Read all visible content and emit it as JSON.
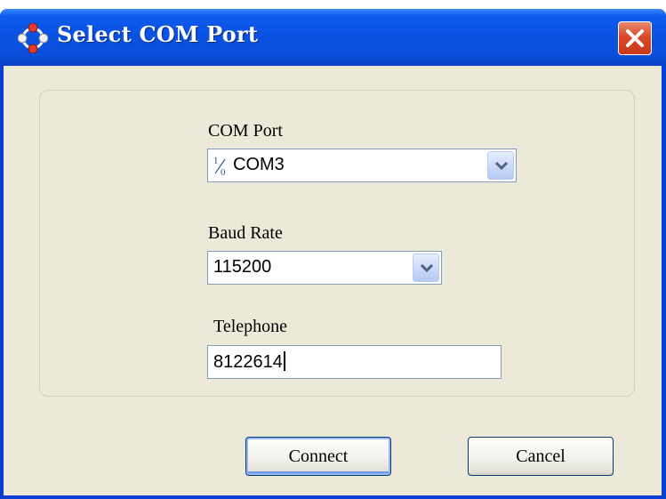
{
  "window": {
    "title": "Select COM Port",
    "title_bar_color": "#0a52e2",
    "client_color": "#ece9d8",
    "icons": {
      "app": "com-port-app-icon",
      "close": "close-icon"
    }
  },
  "form": {
    "com_port": {
      "label": "COM Port",
      "selected": "COM3",
      "item_icon": "io-port-icon"
    },
    "baud_rate": {
      "label": "Baud Rate",
      "selected": "115200"
    },
    "telephone": {
      "label": "Telephone",
      "value": "8122614"
    }
  },
  "buttons": {
    "connect": "Connect",
    "cancel": "Cancel"
  }
}
